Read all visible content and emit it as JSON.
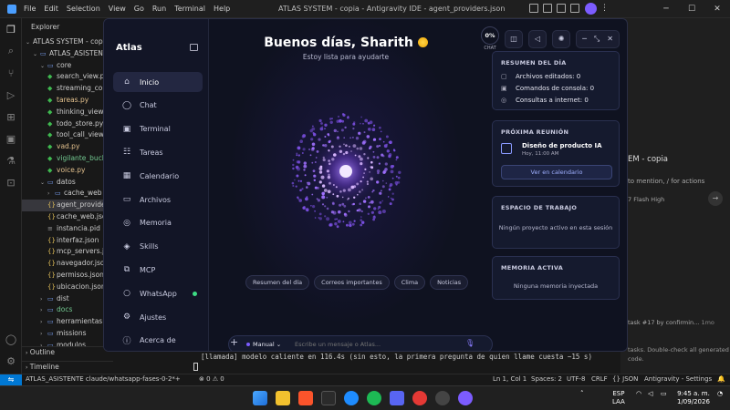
{
  "vscode": {
    "menu": [
      "File",
      "Edit",
      "Selection",
      "View",
      "Go",
      "Run",
      "Terminal",
      "Help"
    ],
    "window_title": "ATLAS SYSTEM - copia - Antigravity IDE - agent_providers.json",
    "explorer_header": "Explorer",
    "tree": [
      {
        "label": "ATLAS SYSTEM - copia",
        "indent": 0,
        "kind": "root"
      },
      {
        "label": "ATLAS_ASISTENTE",
        "indent": 1,
        "kind": "folder-open"
      },
      {
        "label": "core",
        "indent": 2,
        "kind": "folder-open"
      },
      {
        "label": "search_view.py",
        "indent": 3,
        "kind": "py"
      },
      {
        "label": "streaming_con...",
        "indent": 3,
        "kind": "py"
      },
      {
        "label": "tareas.py",
        "indent": 3,
        "kind": "py-mod"
      },
      {
        "label": "thinking_view...",
        "indent": 3,
        "kind": "py"
      },
      {
        "label": "todo_store.py",
        "indent": 3,
        "kind": "py"
      },
      {
        "label": "tool_call_view...",
        "indent": 3,
        "kind": "py"
      },
      {
        "label": "vad.py",
        "indent": 3,
        "kind": "py-mod"
      },
      {
        "label": "vigilante_bucle...",
        "indent": 3,
        "kind": "py-new"
      },
      {
        "label": "voice.py",
        "indent": 3,
        "kind": "py-mod"
      },
      {
        "label": "datos",
        "indent": 2,
        "kind": "folder-open"
      },
      {
        "label": "cache_web",
        "indent": 3,
        "kind": "folder"
      },
      {
        "label": "agent_provide...",
        "indent": 3,
        "kind": "json",
        "selected": true
      },
      {
        "label": "cache_web.json",
        "indent": 3,
        "kind": "json"
      },
      {
        "label": "instancia.pid",
        "indent": 3,
        "kind": "file"
      },
      {
        "label": "interfaz.json",
        "indent": 3,
        "kind": "json"
      },
      {
        "label": "mcp_servers.js...",
        "indent": 3,
        "kind": "json"
      },
      {
        "label": "navegador.json",
        "indent": 3,
        "kind": "json"
      },
      {
        "label": "permisos.json",
        "indent": 3,
        "kind": "json"
      },
      {
        "label": "ubicacion.json",
        "indent": 3,
        "kind": "json"
      },
      {
        "label": "dist",
        "indent": 2,
        "kind": "folder"
      },
      {
        "label": "docs",
        "indent": 2,
        "kind": "folder-green"
      },
      {
        "label": "herramientas",
        "indent": 2,
        "kind": "folder"
      },
      {
        "label": "missions",
        "indent": 2,
        "kind": "folder"
      },
      {
        "label": "modulos",
        "indent": 2,
        "kind": "folder"
      }
    ],
    "outline_label": "Outline",
    "timeline_label": "Timeline",
    "right_pane": {
      "title": "EM - copia",
      "hint": "to mention, / for actions",
      "model": "7 Flash High",
      "task": "task #17 by confirmin...",
      "task_time": "1mo",
      "note": "tasks. Double-check all generated",
      "note2": "code."
    },
    "terminal_line": "[llamada] modelo caliente en 116.4s (sin esto, la primera pregunta de quien llame cuesta ~15 s)",
    "status": {
      "branch": "ATLAS_ASISTENTE  claude/whatsapp-fases-0-2*+",
      "problems": "⊗ 0 ⚠ 0",
      "cursor": "Ln 1, Col 1",
      "spaces": "Spaces: 2",
      "encoding": "UTF-8",
      "eol": "CRLF",
      "language": "{} JSON",
      "settings": "Antigravity - Settings"
    }
  },
  "atlas": {
    "brand": "Atlas",
    "nav": [
      {
        "label": "Inicio",
        "icon": "home-icon",
        "glyph": "⌂",
        "active": true
      },
      {
        "label": "Chat",
        "icon": "chat-icon",
        "glyph": "◯"
      },
      {
        "label": "Terminal",
        "icon": "terminal-icon",
        "glyph": "▣"
      },
      {
        "label": "Tareas",
        "icon": "tasks-icon",
        "glyph": "☷"
      },
      {
        "label": "Calendario",
        "icon": "calendar-icon",
        "glyph": "▦"
      },
      {
        "label": "Archivos",
        "icon": "folder-icon",
        "glyph": "▭"
      },
      {
        "label": "Memoria",
        "icon": "memory-icon",
        "glyph": "◎"
      },
      {
        "label": "Skills",
        "icon": "skills-icon",
        "glyph": "◈"
      },
      {
        "label": "MCP",
        "icon": "mcp-icon",
        "glyph": "⧉"
      },
      {
        "label": "WhatsApp",
        "icon": "whatsapp-icon",
        "glyph": "○",
        "status_dot": true
      },
      {
        "label": "Ajustes",
        "icon": "settings-icon",
        "glyph": "⚙"
      },
      {
        "label": "Acerca de",
        "icon": "info-icon",
        "glyph": "ⓘ"
      }
    ],
    "greeting": "Buenos días, Sharith",
    "subtitle": "Estoy lista para ayudarte",
    "chips": [
      "Resumen del día",
      "Correos importantes",
      "Clima",
      "Noticias"
    ],
    "composer": {
      "mode": "Manual",
      "placeholder": "Escribe un mensaje o Atlas..."
    },
    "top": {
      "chat_percent": "0%",
      "chat_label": "CHAT"
    },
    "resumen": {
      "title": "RESUMEN DEL DÍA",
      "items": [
        {
          "label": "Archivos editados: 0",
          "icon": "file-icon"
        },
        {
          "label": "Comandos de consola: 0",
          "icon": "console-icon"
        },
        {
          "label": "Consultas a internet: 0",
          "icon": "globe-icon"
        }
      ]
    },
    "reunion": {
      "title": "PRÓXIMA REUNIÓN",
      "name": "Diseño de producto IA",
      "when": "Hoy, 11:00 AM",
      "button": "Ver en calendario"
    },
    "espacio": {
      "title": "ESPACIO DE TRABAJO",
      "text": "Ningún proyecto activo en esta sesión"
    },
    "memoria": {
      "title": "MEMORIA ACTIVA",
      "text": "Ninguna memoria inyectada"
    }
  },
  "taskbar": {
    "lang": "ESP",
    "region": "LAA",
    "time": "9:45 a. m.",
    "date": "1/09/2026"
  },
  "colors": {
    "accent": "#7c5cff",
    "vscode_blue": "#0078d4",
    "atlas_bg": "#0f1220",
    "green": "#3ddc84"
  }
}
